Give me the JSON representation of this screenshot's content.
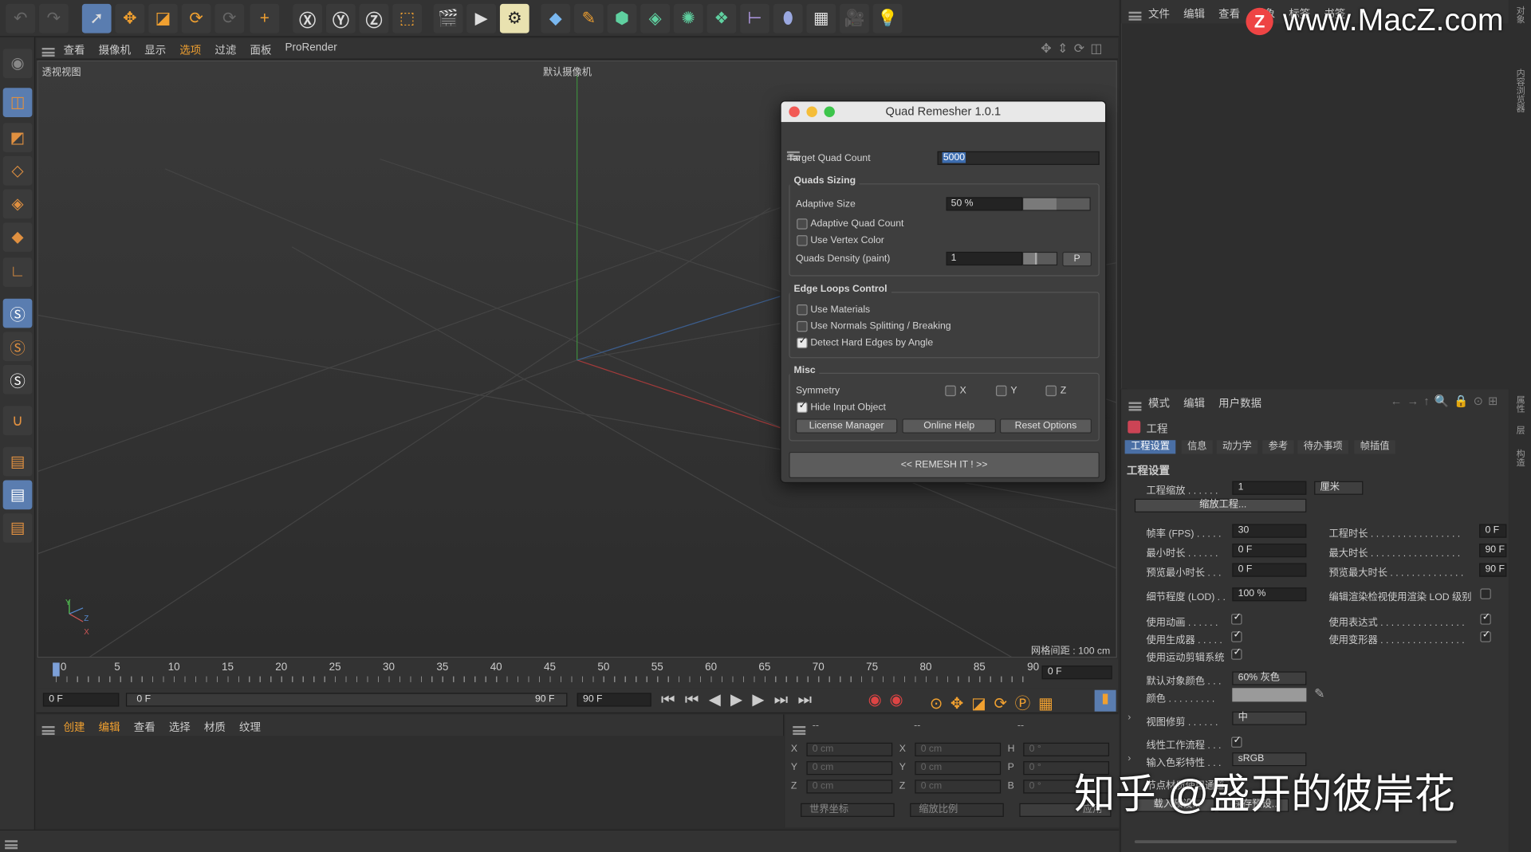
{
  "viewport_menu": [
    "查看",
    "摄像机",
    "显示",
    "选项",
    "过滤",
    "面板",
    "ProRender"
  ],
  "viewport_menu_active": "选项",
  "viewport": {
    "name": "透视视图",
    "camera": "默认摄像机",
    "grid_spacing": "网格间距 : 100 cm",
    "axis_y": "Y",
    "axis_z": "Z",
    "axis_x": "X"
  },
  "right_menu": [
    "文件",
    "编辑",
    "查看",
    "对象",
    "标签",
    "书签"
  ],
  "watermark_site": "www.MacZ.com",
  "watermark_zhihu": "知乎 @盛开的彼岸花",
  "dialog": {
    "title": "Quad Remesher 1.0.1",
    "target_label": "Target Quad Count",
    "target_value": "5000",
    "sizing_title": "Quads Sizing",
    "adaptive_size_label": "Adaptive Size",
    "adaptive_size_value": "50 %",
    "adaptive_size_level": 0.5,
    "adaptive_quad_label": "Adaptive Quad Count",
    "vertex_color_label": "Use Vertex Color",
    "density_label": "Quads Density (paint)",
    "density_value": "1",
    "p_button": "P",
    "edge_title": "Edge Loops Control",
    "use_materials": "Use Materials",
    "normals_split": "Use Normals Splitting / Breaking",
    "hard_edges": "Detect Hard Edges by Angle",
    "misc_title": "Misc",
    "symmetry": "Symmetry",
    "sym_x": "X",
    "sym_y": "Y",
    "sym_z": "Z",
    "hide_input": "Hide Input Object",
    "license_btn": "License Manager",
    "help_btn": "Online Help",
    "reset_btn": "Reset Options",
    "remesh_btn": "<<   REMESH IT !   >>"
  },
  "timeline": {
    "ticks": [
      "0",
      "5",
      "10",
      "15",
      "20",
      "25",
      "30",
      "35",
      "40",
      "45",
      "50",
      "55",
      "60",
      "65",
      "70",
      "75",
      "80",
      "85",
      "90"
    ],
    "frame_end_field": "0 F",
    "start": "0 F",
    "range_start": "0 F",
    "range_end": "90 F",
    "end": "90 F"
  },
  "bottom_menu": [
    "创建",
    "编辑",
    "查看",
    "选择",
    "材质",
    "纹理"
  ],
  "coords": {
    "header": [
      "--",
      "--",
      "--"
    ],
    "rows": [
      {
        "a": "X",
        "av": "0 cm",
        "b": "X",
        "bv": "0 cm",
        "c": "H",
        "cv": "0 °"
      },
      {
        "a": "Y",
        "av": "0 cm",
        "b": "Y",
        "bv": "0 cm",
        "c": "P",
        "cv": "0 °"
      },
      {
        "a": "Z",
        "av": "0 cm",
        "b": "Z",
        "bv": "0 cm",
        "c": "B",
        "cv": "0 °"
      }
    ],
    "world": "世界坐标",
    "scale": "缩放比例",
    "apply": "应用"
  },
  "attr": {
    "menu": [
      "模式",
      "编辑",
      "用户数据"
    ],
    "object": "工程",
    "tabs": [
      "工程设置",
      "信息",
      "动力学",
      "参考",
      "待办事项",
      "帧插值"
    ],
    "section": "工程设置",
    "scale_label": "工程缩放 . . . . . .",
    "scale_value": "1",
    "scale_unit": "厘米",
    "scale_btn": "缩放工程...",
    "fps_label": "帧率 (FPS) . . . . .",
    "fps_value": "30",
    "len_label": "工程时长 . . . . . . . . . . . . . . . . .",
    "len_value": "0 F",
    "min_label": "最小时长 . . . . . .",
    "min_value": "0 F",
    "max_label": "最大时长 . . . . . . . . . . . . . . . . .",
    "max_value": "90 F",
    "pmin_label": "预览最小时长 . . .",
    "pmin_value": "0 F",
    "pmax_label": "预览最大时长 . . . . . . . . . . . . . .",
    "pmax_value": "90 F",
    "lod_label": "细节程度 (LOD) . .",
    "lod_value": "100 %",
    "lod_render_label": "编辑渲染检视使用渲染 LOD 级别",
    "anim_label": "使用动画 . . . . . .",
    "expr_label": "使用表达式 . . . . . . . . . . . . . . . .",
    "gen_label": "使用生成器 . . . . .",
    "deform_label": "使用变形器 . . . . . . . . . . . . . . . .",
    "motion_label": "使用运动剪辑系统",
    "objcolor_label": "默认对象颜色 . . .",
    "objcolor_value": "60% 灰色",
    "color_label": "颜色 . . . . . . . . .",
    "clip_label": "视图修剪 . . . . . .",
    "clip_value": "中",
    "linear_label": "线性工作流程 . . .",
    "input_label": "输入色彩特性 . . .",
    "input_value": "sRGB",
    "node_label": "节点材质使用通道",
    "load_btn": "载入预设...",
    "save_btn": "保存预设..."
  },
  "side_tabs_right": [
    "对象",
    "内容浏览器",
    "属性",
    "层",
    "构造"
  ]
}
